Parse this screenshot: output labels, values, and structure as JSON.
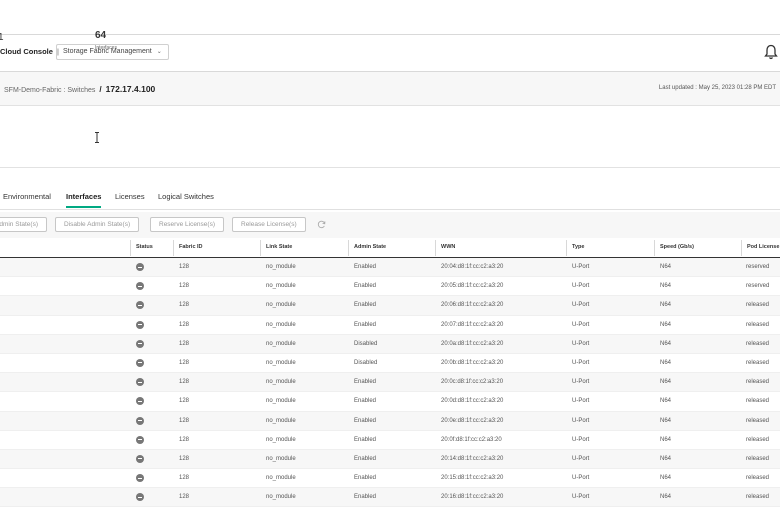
{
  "header": {
    "brand": "Cloud Console",
    "brand_sep": "|",
    "app_name": "Storage Fabric Management",
    "chevron": "⌄",
    "bell_icon": "bell-icon"
  },
  "breadcrumb": {
    "path": "SFM-Demo-Fabric : Switches",
    "separator": "/",
    "current": "172.17.4.100",
    "last_updated": "Last updated :  May 25, 2023 01:28 PM EDT"
  },
  "stats": {
    "first_value": "1",
    "second_value": "64",
    "second_label": "Interfaces"
  },
  "tabs": [
    {
      "label": "Environmental"
    },
    {
      "label": "Interfaces",
      "active": true
    },
    {
      "label": "Licenses"
    },
    {
      "label": "Logical Switches"
    }
  ],
  "toolbar": {
    "buttons": [
      "Admin State(s)",
      "Disable Admin State(s)",
      "Reserve License(s)",
      "Release License(s)"
    ],
    "refresh_icon": "refresh-icon"
  },
  "table": {
    "columns": [
      "Status",
      "Fabric ID",
      "Link State",
      "Admin State",
      "WWN",
      "Type",
      "Speed (Gb/s)",
      "Pod License"
    ],
    "rows": [
      [
        "128",
        "no_module",
        "Enabled",
        "20:04:d8:1f:cc:c2:a3:20",
        "U-Port",
        "N64",
        "reserved"
      ],
      [
        "128",
        "no_module",
        "Enabled",
        "20:05:d8:1f:cc:c2:a3:20",
        "U-Port",
        "N64",
        "reserved"
      ],
      [
        "128",
        "no_module",
        "Enabled",
        "20:06:d8:1f:cc:c2:a3:20",
        "U-Port",
        "N64",
        "released"
      ],
      [
        "128",
        "no_module",
        "Enabled",
        "20:07:d8:1f:cc:c2:a3:20",
        "U-Port",
        "N64",
        "released"
      ],
      [
        "128",
        "no_module",
        "Disabled",
        "20:0a:d8:1f:cc:c2:a3:20",
        "U-Port",
        "N64",
        "released"
      ],
      [
        "128",
        "no_module",
        "Disabled",
        "20:0b:d8:1f:cc:c2:a3:20",
        "U-Port",
        "N64",
        "released"
      ],
      [
        "128",
        "no_module",
        "Enabled",
        "20:0c:d8:1f:cc:c2:a3:20",
        "U-Port",
        "N64",
        "released"
      ],
      [
        "128",
        "no_module",
        "Enabled",
        "20:0d:d8:1f:cc:c2:a3:20",
        "U-Port",
        "N64",
        "released"
      ],
      [
        "128",
        "no_module",
        "Enabled",
        "20:0e:d8:1f:cc:c2:a3:20",
        "U-Port",
        "N64",
        "released"
      ],
      [
        "128",
        "no_module",
        "Enabled",
        "20:0f:d8:1f:cc:c2:a3:20",
        "U-Port",
        "N64",
        "released"
      ],
      [
        "128",
        "no_module",
        "Enabled",
        "20:14:d8:1f:cc:c2:a3:20",
        "U-Port",
        "N64",
        "released"
      ],
      [
        "128",
        "no_module",
        "Enabled",
        "20:15:d8:1f:cc:c2:a3:20",
        "U-Port",
        "N64",
        "released"
      ],
      [
        "128",
        "no_module",
        "Enabled",
        "20:16:d8:1f:cc:c2:a3:20",
        "U-Port",
        "N64",
        "released"
      ]
    ]
  },
  "colors": {
    "accent": "#01a982",
    "status_offline": "#777777"
  }
}
